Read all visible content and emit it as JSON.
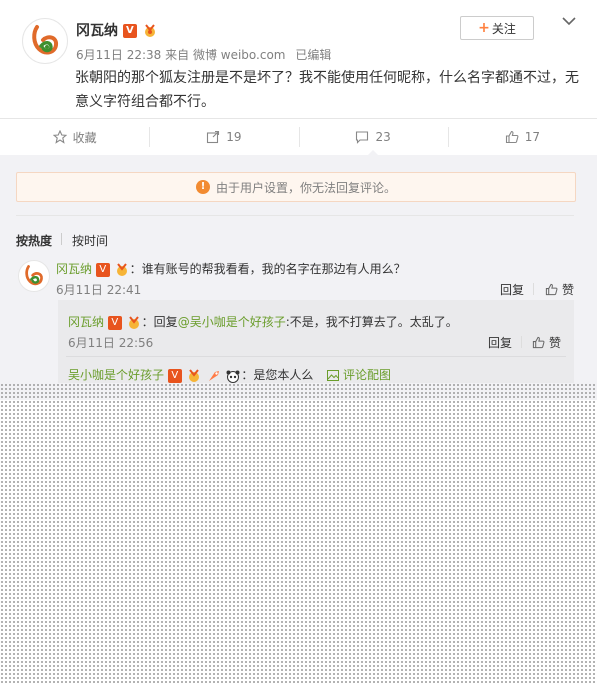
{
  "post": {
    "author": "冈瓦纳",
    "v_badge": "V",
    "time": "6月11日 22:38",
    "source": "来自 微博 weibo.com",
    "edited": "已编辑",
    "follow_label": "关注",
    "text": "张朝阳的那个狐友注册是不是坏了？我不能使用任何昵称，什么名字都通不过，无意义字符组合都不行。"
  },
  "actions": {
    "favorite": "收藏",
    "repost_count": "19",
    "comment_count": "23",
    "like_count": "17"
  },
  "notice": "由于用户设置，你无法回复评论。",
  "sort": {
    "hot": "按热度",
    "time": "按时间"
  },
  "comments": [
    {
      "author": "冈瓦纳",
      "text": "：谁有账号的帮我看看，我的名字在那边有人用么？",
      "time": "6月11日 22:41",
      "reply": "回复",
      "like": "赞"
    }
  ],
  "sub_comments": [
    {
      "author": "冈瓦纳",
      "prefix": "：回复",
      "mention": "@吴小咖是个好孩子",
      "text": ":不是，我不打算去了。太乱了。",
      "time": "6月11日 22:56",
      "reply": "回复",
      "like": "赞"
    },
    {
      "author": "吴小咖是个好孩子",
      "text": "：是您本人么",
      "pic_link": "评论配图"
    }
  ],
  "colors": {
    "accent_orange": "#ff8140",
    "v_badge": "#e8541e",
    "link_green": "#6a9d2b",
    "notice_bg": "#fef6ef"
  }
}
